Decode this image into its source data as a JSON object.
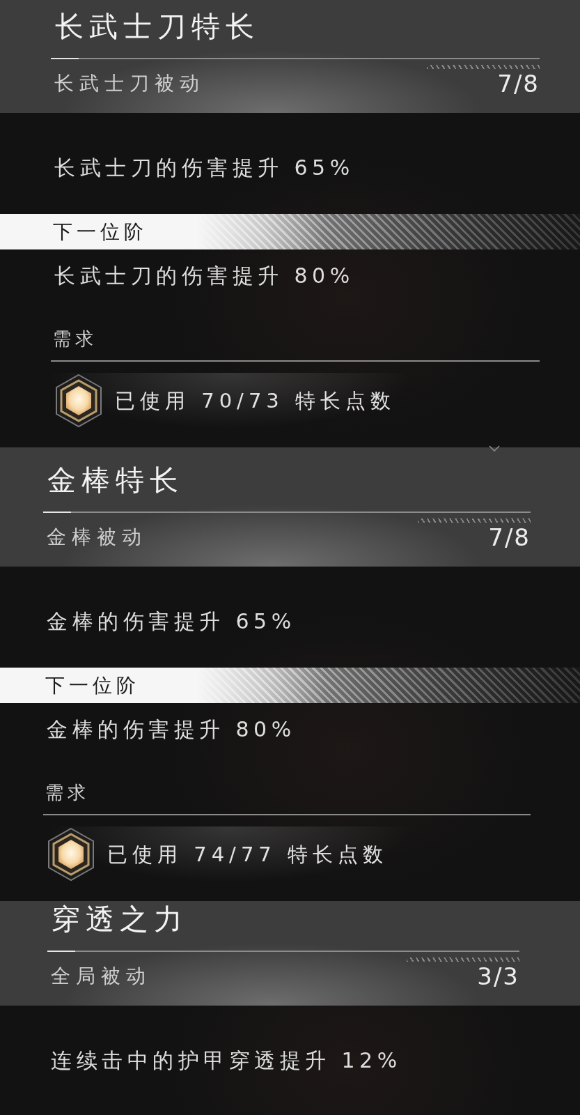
{
  "perks": [
    {
      "title": "长武士刀特长",
      "type": "长武士刀被动",
      "rank": "7/8",
      "effect": "长武士刀的伤害提升 65%",
      "next_tier": {
        "label": "下一位阶",
        "effect": "长武士刀的伤害提升 80%"
      },
      "requirement": {
        "label": "需求",
        "text": "已使用 70/73 特长点数"
      }
    },
    {
      "title": "金棒特长",
      "type": "金棒被动",
      "rank": "7/8",
      "has_pointer": true,
      "effect": "金棒的伤害提升 65%",
      "next_tier": {
        "label": "下一位阶",
        "effect": "金棒的伤害提升 80%"
      },
      "requirement": {
        "label": "需求",
        "text": "已使用 74/77 特长点数"
      }
    },
    {
      "title": "穿透之力",
      "type": "全局被动",
      "rank": "3/3",
      "effect": "连续击中的护甲穿透提升 12%"
    }
  ]
}
